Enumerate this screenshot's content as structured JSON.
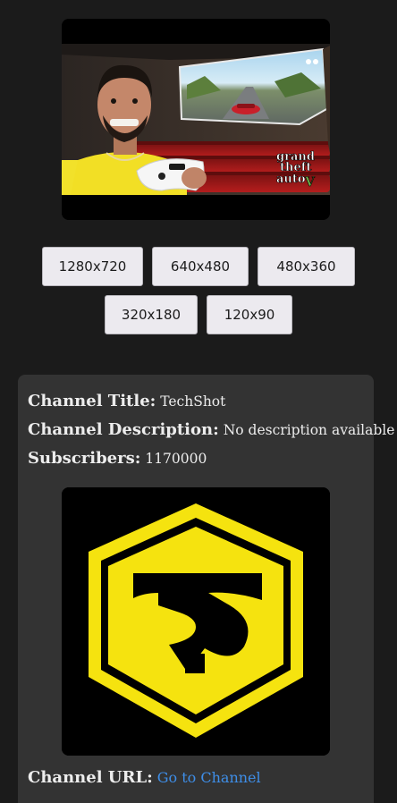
{
  "thumbnail": {
    "overlay_lines": [
      "grand",
      "theft",
      "auto",
      "V"
    ],
    "icon": "video-thumbnail-image"
  },
  "resolutions": {
    "row1": [
      "1280x720",
      "640x480",
      "480x360"
    ],
    "row2": [
      "320x180",
      "120x90"
    ]
  },
  "channel": {
    "title_label": "Channel Title:",
    "title_value": "TechShot",
    "description_label": "Channel Description:",
    "description_value": "No description available",
    "subscribers_label": "Subscribers:",
    "subscribers_value": "1170000",
    "url_label": "Channel URL:",
    "url_link_text": "Go to Channel",
    "logo_icon": "channel-logo-image"
  },
  "colors": {
    "background": "#1b1b1b",
    "card": "#333333",
    "link": "#3e8ee8",
    "logo_yellow": "#f5e30f"
  }
}
